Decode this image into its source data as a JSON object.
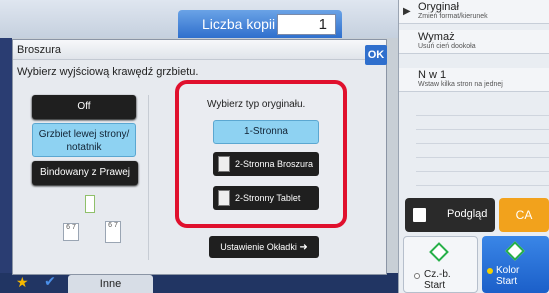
{
  "header": {
    "copies_label": "Liczba kopii",
    "copies_value": "1"
  },
  "right_panel": {
    "items": [
      {
        "title": "Oryginał",
        "subtitle": "Zmień format/kierunek"
      },
      {
        "title": "Wymaż",
        "subtitle": "Usuń cień dookoła"
      },
      {
        "title": "N w 1",
        "subtitle": "Wstaw kilka stron na jednej"
      }
    ],
    "preview_label": "Podgląd",
    "ca_label": "CA",
    "start_bw": {
      "line1": "Cz.-b.",
      "line2": "Start"
    },
    "start_color": {
      "line1": "Kolor",
      "line2": "Start"
    }
  },
  "bottom_bar": {
    "inne_label": "Inne"
  },
  "dialog": {
    "title": "Broszura",
    "subtitle": "Wybierz wyjściową krawędź grzbietu.",
    "ok_label": "OK",
    "binding_options": [
      {
        "label": "Off",
        "selected": false
      },
      {
        "label": "Grzbiet lewej strony/ notatnik",
        "selected": true
      },
      {
        "label": "Bindowany z Prawej",
        "selected": false
      }
    ],
    "original_type_label": "Wybierz typ oryginału.",
    "original_types": [
      {
        "label": "1-Stronna",
        "selected": true
      },
      {
        "label": "2-Stronna Broszura",
        "selected": false
      },
      {
        "label": "2-Stronny Tablet",
        "selected": false
      }
    ],
    "cover_button_label": "Ustawienie Okładki"
  },
  "colors": {
    "accent": "#2f6fcd",
    "selected": "#8ed2f2",
    "highlight": "#e0102d",
    "ca": "#f2a21c"
  }
}
